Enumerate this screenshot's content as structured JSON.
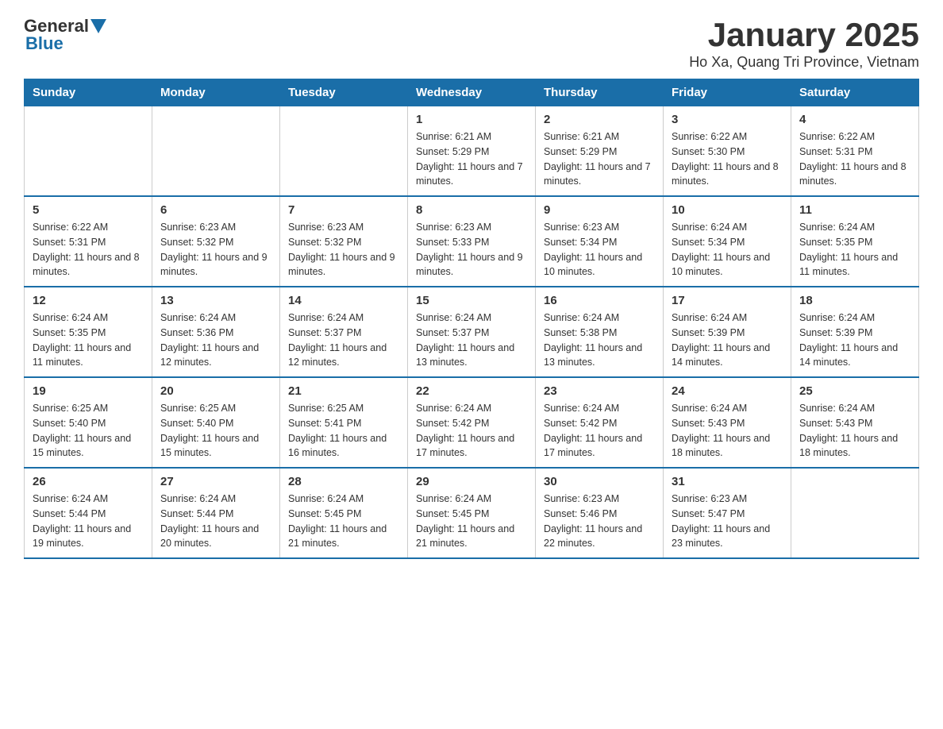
{
  "header": {
    "logo_general": "General",
    "logo_blue": "Blue",
    "month_year": "January 2025",
    "location": "Ho Xa, Quang Tri Province, Vietnam"
  },
  "days_of_week": [
    "Sunday",
    "Monday",
    "Tuesday",
    "Wednesday",
    "Thursday",
    "Friday",
    "Saturday"
  ],
  "weeks": [
    [
      {
        "day": "",
        "info": ""
      },
      {
        "day": "",
        "info": ""
      },
      {
        "day": "",
        "info": ""
      },
      {
        "day": "1",
        "info": "Sunrise: 6:21 AM\nSunset: 5:29 PM\nDaylight: 11 hours and 7 minutes."
      },
      {
        "day": "2",
        "info": "Sunrise: 6:21 AM\nSunset: 5:29 PM\nDaylight: 11 hours and 7 minutes."
      },
      {
        "day": "3",
        "info": "Sunrise: 6:22 AM\nSunset: 5:30 PM\nDaylight: 11 hours and 8 minutes."
      },
      {
        "day": "4",
        "info": "Sunrise: 6:22 AM\nSunset: 5:31 PM\nDaylight: 11 hours and 8 minutes."
      }
    ],
    [
      {
        "day": "5",
        "info": "Sunrise: 6:22 AM\nSunset: 5:31 PM\nDaylight: 11 hours and 8 minutes."
      },
      {
        "day": "6",
        "info": "Sunrise: 6:23 AM\nSunset: 5:32 PM\nDaylight: 11 hours and 9 minutes."
      },
      {
        "day": "7",
        "info": "Sunrise: 6:23 AM\nSunset: 5:32 PM\nDaylight: 11 hours and 9 minutes."
      },
      {
        "day": "8",
        "info": "Sunrise: 6:23 AM\nSunset: 5:33 PM\nDaylight: 11 hours and 9 minutes."
      },
      {
        "day": "9",
        "info": "Sunrise: 6:23 AM\nSunset: 5:34 PM\nDaylight: 11 hours and 10 minutes."
      },
      {
        "day": "10",
        "info": "Sunrise: 6:24 AM\nSunset: 5:34 PM\nDaylight: 11 hours and 10 minutes."
      },
      {
        "day": "11",
        "info": "Sunrise: 6:24 AM\nSunset: 5:35 PM\nDaylight: 11 hours and 11 minutes."
      }
    ],
    [
      {
        "day": "12",
        "info": "Sunrise: 6:24 AM\nSunset: 5:35 PM\nDaylight: 11 hours and 11 minutes."
      },
      {
        "day": "13",
        "info": "Sunrise: 6:24 AM\nSunset: 5:36 PM\nDaylight: 11 hours and 12 minutes."
      },
      {
        "day": "14",
        "info": "Sunrise: 6:24 AM\nSunset: 5:37 PM\nDaylight: 11 hours and 12 minutes."
      },
      {
        "day": "15",
        "info": "Sunrise: 6:24 AM\nSunset: 5:37 PM\nDaylight: 11 hours and 13 minutes."
      },
      {
        "day": "16",
        "info": "Sunrise: 6:24 AM\nSunset: 5:38 PM\nDaylight: 11 hours and 13 minutes."
      },
      {
        "day": "17",
        "info": "Sunrise: 6:24 AM\nSunset: 5:39 PM\nDaylight: 11 hours and 14 minutes."
      },
      {
        "day": "18",
        "info": "Sunrise: 6:24 AM\nSunset: 5:39 PM\nDaylight: 11 hours and 14 minutes."
      }
    ],
    [
      {
        "day": "19",
        "info": "Sunrise: 6:25 AM\nSunset: 5:40 PM\nDaylight: 11 hours and 15 minutes."
      },
      {
        "day": "20",
        "info": "Sunrise: 6:25 AM\nSunset: 5:40 PM\nDaylight: 11 hours and 15 minutes."
      },
      {
        "day": "21",
        "info": "Sunrise: 6:25 AM\nSunset: 5:41 PM\nDaylight: 11 hours and 16 minutes."
      },
      {
        "day": "22",
        "info": "Sunrise: 6:24 AM\nSunset: 5:42 PM\nDaylight: 11 hours and 17 minutes."
      },
      {
        "day": "23",
        "info": "Sunrise: 6:24 AM\nSunset: 5:42 PM\nDaylight: 11 hours and 17 minutes."
      },
      {
        "day": "24",
        "info": "Sunrise: 6:24 AM\nSunset: 5:43 PM\nDaylight: 11 hours and 18 minutes."
      },
      {
        "day": "25",
        "info": "Sunrise: 6:24 AM\nSunset: 5:43 PM\nDaylight: 11 hours and 18 minutes."
      }
    ],
    [
      {
        "day": "26",
        "info": "Sunrise: 6:24 AM\nSunset: 5:44 PM\nDaylight: 11 hours and 19 minutes."
      },
      {
        "day": "27",
        "info": "Sunrise: 6:24 AM\nSunset: 5:44 PM\nDaylight: 11 hours and 20 minutes."
      },
      {
        "day": "28",
        "info": "Sunrise: 6:24 AM\nSunset: 5:45 PM\nDaylight: 11 hours and 21 minutes."
      },
      {
        "day": "29",
        "info": "Sunrise: 6:24 AM\nSunset: 5:45 PM\nDaylight: 11 hours and 21 minutes."
      },
      {
        "day": "30",
        "info": "Sunrise: 6:23 AM\nSunset: 5:46 PM\nDaylight: 11 hours and 22 minutes."
      },
      {
        "day": "31",
        "info": "Sunrise: 6:23 AM\nSunset: 5:47 PM\nDaylight: 11 hours and 23 minutes."
      },
      {
        "day": "",
        "info": ""
      }
    ]
  ]
}
